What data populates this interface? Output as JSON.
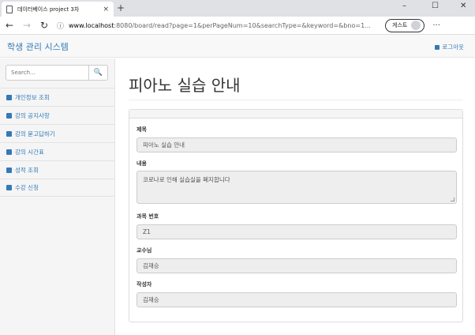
{
  "browser": {
    "tab_title": "데이터베이스 project 3차",
    "tab_close": "×",
    "new_tab": "+",
    "minimize": "–",
    "maximize": "☐",
    "close": "✕",
    "back": "←",
    "forward": "→",
    "reload": "↻",
    "info": "ⓘ",
    "url_host": "www.localhost",
    "url_rest": ":8080/board/read?page=1&perPageNum=10&searchType=&keyword=&bno=1...",
    "guest_label": "게스트",
    "menu": "···"
  },
  "app": {
    "brand": "학생 관리 시스템",
    "logout": "로그아웃"
  },
  "sidebar": {
    "search_placeholder": "Search...",
    "search_button": "🔍",
    "items": [
      {
        "label": "개인정보 조회",
        "icon": "user-icon"
      },
      {
        "label": "강의 공지사항",
        "icon": "book-icon"
      },
      {
        "label": "강의 묻고답하기",
        "icon": "edit-icon"
      },
      {
        "label": "강의 시간표",
        "icon": "table-icon"
      },
      {
        "label": "성적 조회",
        "icon": "bar-chart-icon"
      },
      {
        "label": "수강 신청",
        "icon": "table-icon"
      }
    ]
  },
  "main": {
    "title": "피아노 실습 안내",
    "fields": {
      "title_label": "제목",
      "title_value": "피아노 실습 안내",
      "content_label": "내용",
      "content_value": "코로나로 인해 실습실을 폐지합니다",
      "course_label": "과목 번호",
      "course_value": "Z1",
      "professor_label": "교수님",
      "professor_value": "김재승",
      "writer_label": "작성자",
      "writer_value": "김재승"
    }
  }
}
